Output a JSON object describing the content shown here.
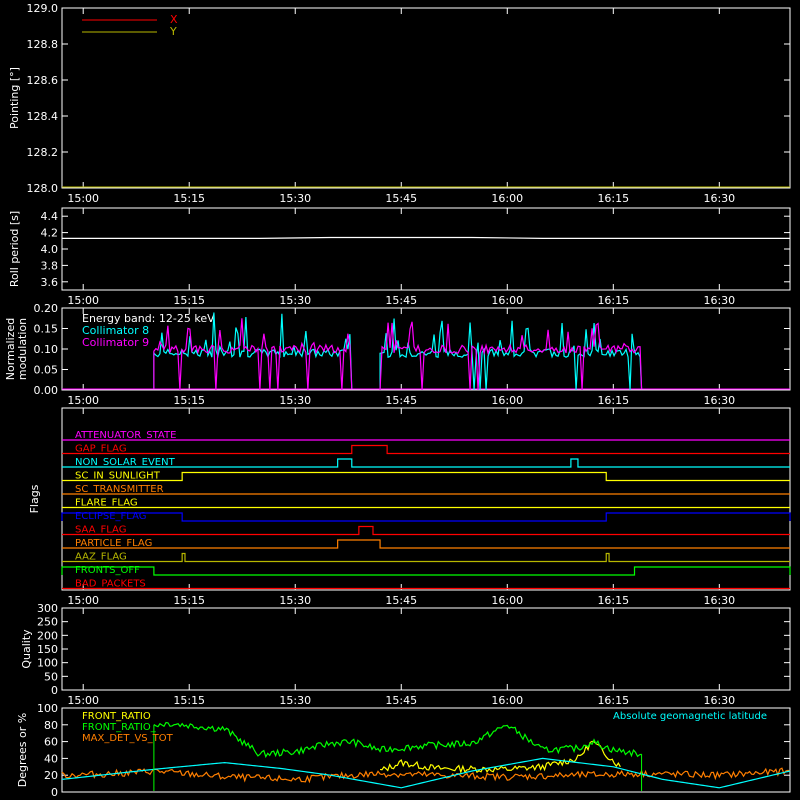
{
  "chart_data": [
    {
      "type": "line",
      "ylabel": "Pointing [°]",
      "ylim": [
        128.0,
        129.0
      ],
      "yticks": [
        "128.0",
        "128.2",
        "128.4",
        "128.6",
        "128.8",
        "129.0"
      ],
      "xticks": [
        "15:00",
        "15:15",
        "15:30",
        "15:45",
        "16:00",
        "16:15",
        "16:30"
      ],
      "series": [
        {
          "name": "X",
          "color": "#ff0000",
          "x": [],
          "y": []
        },
        {
          "name": "Y",
          "color": "#b7b700",
          "x": [],
          "y": []
        }
      ]
    },
    {
      "type": "line",
      "ylabel": "Roll period [s]",
      "ylim": [
        3.5,
        4.5
      ],
      "yticks": [
        "3.6",
        "3.8",
        "4.0",
        "4.2",
        "4.4"
      ],
      "xticks": [
        "15:00",
        "15:15",
        "15:30",
        "15:45",
        "16:00",
        "16:15",
        "16:30"
      ],
      "series": [
        {
          "name": "",
          "color": "#ffffff",
          "x": [
            "14:57",
            "15:10",
            "15:25",
            "15:35",
            "15:45",
            "15:55",
            "16:05",
            "16:15",
            "16:25",
            "16:35",
            "16:40"
          ],
          "y": [
            4.13,
            4.13,
            4.13,
            4.14,
            4.14,
            4.14,
            4.13,
            4.13,
            4.13,
            4.13,
            4.13
          ]
        }
      ]
    },
    {
      "type": "line",
      "ylabel": "Normalized modulation",
      "ylim": [
        0.0,
        0.2
      ],
      "yticks": [
        "0.00",
        "0.05",
        "0.10",
        "0.15",
        "0.20"
      ],
      "xticks": [
        "15:00",
        "15:15",
        "15:30",
        "15:45",
        "16:00",
        "16:15",
        "16:30"
      ],
      "annotation": "Energy band: 12-25 keV",
      "series": [
        {
          "name": "Collimator 8",
          "color": "#00ffff",
          "segments": [
            [
              "15:10",
              "15:38"
            ],
            [
              "15:42",
              "16:19"
            ]
          ],
          "baseline": 0.09,
          "peak": 0.19
        },
        {
          "name": "Collimator 9",
          "color": "#ff00ff",
          "segments": [
            [
              "15:10",
              "15:38"
            ],
            [
              "15:42",
              "16:19"
            ]
          ],
          "baseline": 0.1,
          "peak": 0.18
        }
      ]
    },
    {
      "type": "line",
      "ylabel": "Flags",
      "xticks": [
        "15:00",
        "15:15",
        "15:30",
        "15:45",
        "16:00",
        "16:15",
        "16:30"
      ],
      "flags": [
        {
          "name": "ATTENUATOR_STATE",
          "color": "#ff00ff",
          "on": []
        },
        {
          "name": "GAP_FLAG",
          "color": "#ff0000",
          "on": [
            [
              "15:38",
              "15:43"
            ]
          ]
        },
        {
          "name": "NON_SOLAR_EVENT",
          "color": "#00ffff",
          "on": [
            [
              "15:36",
              "15:38"
            ],
            [
              "16:09",
              "16:10"
            ]
          ]
        },
        {
          "name": "SC_IN_SUNLIGHT",
          "color": "#ffff00",
          "on": [
            [
              "15:14",
              "16:14"
            ]
          ]
        },
        {
          "name": "SC_TRANSMITTER",
          "color": "#ff7f00",
          "on": []
        },
        {
          "name": "FLARE_FLAG",
          "color": "#ffff00",
          "on": []
        },
        {
          "name": "ECLIPSE_FLAG",
          "color": "#0000ff",
          "on": [
            [
              "14:57",
              "15:14"
            ],
            [
              "16:14",
              "16:40"
            ]
          ]
        },
        {
          "name": "SAA_FLAG",
          "color": "#ff0000",
          "on": [
            [
              "15:39",
              "15:41"
            ]
          ]
        },
        {
          "name": "PARTICLE_FLAG",
          "color": "#ff7f00",
          "on": [
            [
              "15:36",
              "15:42"
            ]
          ]
        },
        {
          "name": "AAZ_FLAG",
          "color": "#b7b700",
          "on": [
            [
              "15:14",
              "15:14.4"
            ],
            [
              "16:14",
              "16:14.4"
            ]
          ]
        },
        {
          "name": "FRONTS_OFF",
          "color": "#00ff00",
          "on": [
            [
              "14:57",
              "15:10"
            ],
            [
              "16:18",
              "16:40"
            ]
          ]
        },
        {
          "name": "BAD_PACKETS",
          "color": "#ff0000",
          "on": []
        }
      ]
    },
    {
      "type": "line",
      "ylabel": "Quality",
      "ylim": [
        0,
        300
      ],
      "yticks": [
        "0",
        "50",
        "100",
        "150",
        "200",
        "250",
        "300"
      ],
      "xticks": [
        "15:00",
        "15:15",
        "15:30",
        "15:45",
        "16:00",
        "16:15",
        "16:30"
      ],
      "series": []
    },
    {
      "type": "line",
      "ylabel": "Degrees or %",
      "ylim": [
        0,
        100
      ],
      "yticks": [
        "0",
        "20",
        "40",
        "60",
        "80",
        "100"
      ],
      "legend_right": "Absolute geomagnetic latitude",
      "series": [
        {
          "name": "FRONT_RATIO",
          "color": "#ffff00",
          "x": [
            "15:42",
            "15:45",
            "15:50",
            "16:00",
            "16:05",
            "16:10",
            "16:12",
            "16:14",
            "16:16"
          ],
          "y": [
            25,
            35,
            28,
            27,
            30,
            40,
            60,
            45,
            30
          ]
        },
        {
          "name": "FRONT_RATIO_",
          "color": "#00ff00",
          "x": [
            "15:10",
            "15:12",
            "15:20",
            "15:25",
            "15:30",
            "15:35",
            "15:38",
            "15:42",
            "15:48",
            "15:55",
            "16:00",
            "16:05",
            "16:10",
            "16:12",
            "16:15",
            "16:19"
          ],
          "y": [
            80,
            82,
            75,
            45,
            48,
            58,
            60,
            50,
            55,
            58,
            80,
            50,
            52,
            60,
            50,
            45
          ]
        },
        {
          "name": "MAX_DET_VS_TOT",
          "color": "#ff7f00",
          "x": [
            "14:57",
            "15:05",
            "15:10",
            "15:20",
            "15:30",
            "15:38",
            "15:42",
            "15:50",
            "16:00",
            "16:10",
            "16:19",
            "16:30",
            "16:40"
          ],
          "y": [
            20,
            22,
            25,
            18,
            15,
            20,
            22,
            20,
            18,
            20,
            22,
            20,
            25
          ]
        },
        {
          "name": "Absolute geomagnetic latitude",
          "color": "#00ffff",
          "x": [
            "14:57",
            "15:10",
            "15:20",
            "15:28",
            "15:35",
            "15:45",
            "15:55",
            "16:05",
            "16:15",
            "16:22",
            "16:30",
            "16:40"
          ],
          "y": [
            15,
            27,
            35,
            28,
            20,
            5,
            25,
            40,
            30,
            15,
            5,
            25
          ]
        }
      ]
    }
  ]
}
